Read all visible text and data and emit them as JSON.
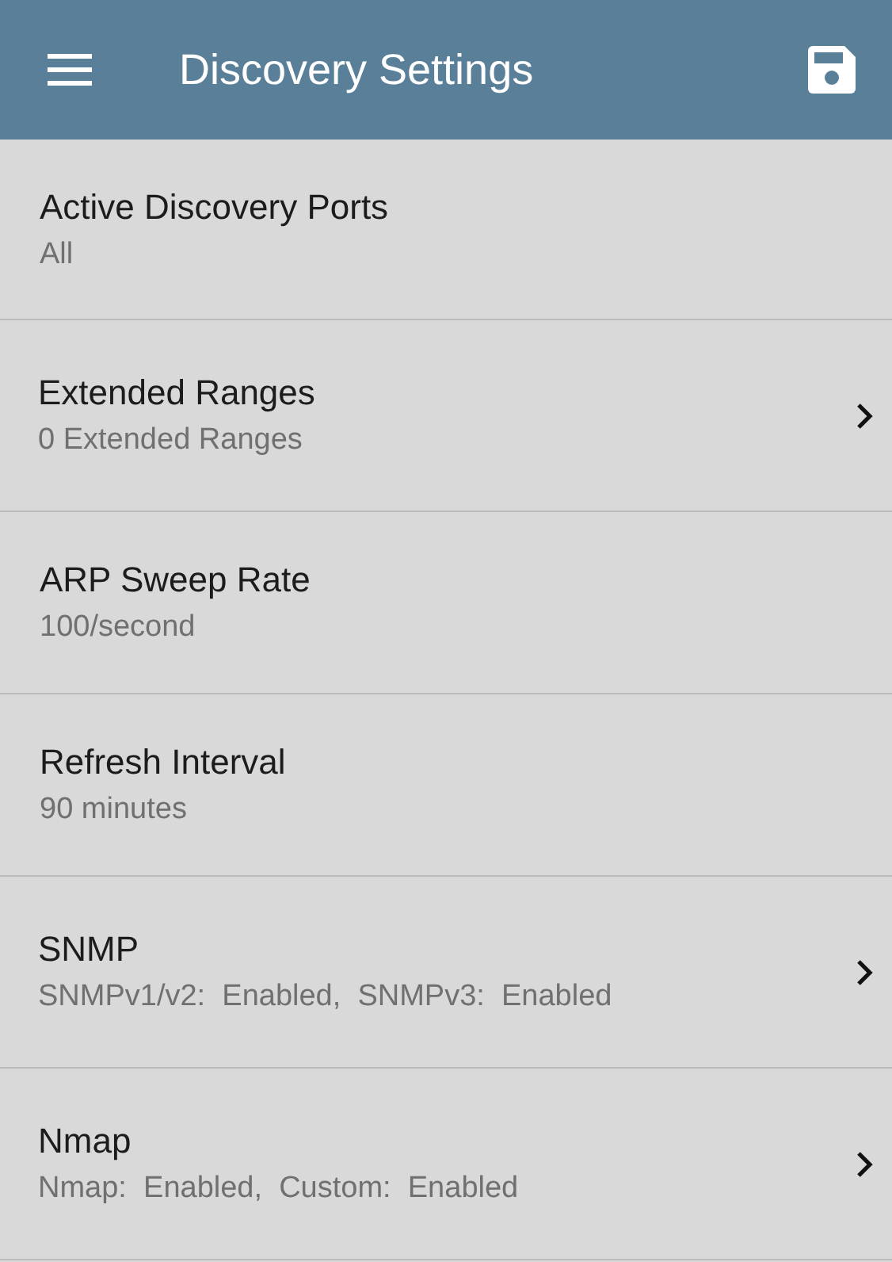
{
  "app_bar": {
    "title": "Discovery Settings"
  },
  "settings": [
    {
      "kind": "plain",
      "title": "Active Discovery Ports",
      "value": "All"
    },
    {
      "kind": "link",
      "title": "Extended Ranges",
      "value": "0 Extended Ranges"
    },
    {
      "kind": "plain",
      "title": "ARP Sweep Rate",
      "value": "100/second"
    },
    {
      "kind": "plain",
      "title": "Refresh Interval",
      "value": "90 minutes"
    },
    {
      "kind": "link",
      "title": "SNMP",
      "value": "SNMPv1/v2:  Enabled,  SNMPv3:  Enabled"
    },
    {
      "kind": "link",
      "title": "Nmap",
      "value": "Nmap:  Enabled,  Custom:  Enabled"
    }
  ]
}
